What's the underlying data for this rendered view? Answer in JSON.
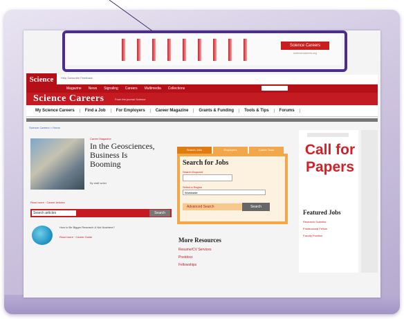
{
  "ad": {
    "brand": "Science Careers",
    "sub": "sciencecareers.org"
  },
  "top_nav": {
    "logo": "Science",
    "tiny_links": "Help  Subscribe  Feedback",
    "red_items": [
      "Magazine",
      "News",
      "Signaling",
      "Careers",
      "Multimedia",
      "Collections"
    ]
  },
  "careers": {
    "title": "Science Careers",
    "tagline": "From the journal Science"
  },
  "subnav": [
    "My Science Careers",
    "Find a Job",
    "For Employers",
    "Career Magazine",
    "Grants & Funding",
    "Tools & Tips",
    "Forums"
  ],
  "breadcrumb": "Science Careers > Home",
  "feature": {
    "kicker": "Career Magazine",
    "headline": "In the Geosciences, Business Is Booming",
    "blurb": "By staff writer",
    "links": "Read more  ·  Career Articles",
    "search_placeholder": "Search articles",
    "search_button": "Search"
  },
  "item2": {
    "text": "How to Be Bigger Research & Not Nowhere?",
    "links": "Read more  ·  Career Guide"
  },
  "jobs": {
    "tabs": [
      "Search Jobs",
      "Employers",
      "Career Tools"
    ],
    "title": "Search for Jobs",
    "label_keyword": "Search Keyword",
    "label_region": "Select a Region",
    "region_value": "Worldwide",
    "advanced": "Advanced Search",
    "button": "Search"
  },
  "more": {
    "title": "More Resources",
    "links": [
      "Resume/CV Services",
      "Postdocs",
      "Fellowships"
    ]
  },
  "right": {
    "ad_title": "Call for Papers",
    "featured_title": "Featured Jobs",
    "featured_lines": [
      "Research Scientist",
      "Postdoctoral Fellow",
      "Faculty Position"
    ]
  }
}
